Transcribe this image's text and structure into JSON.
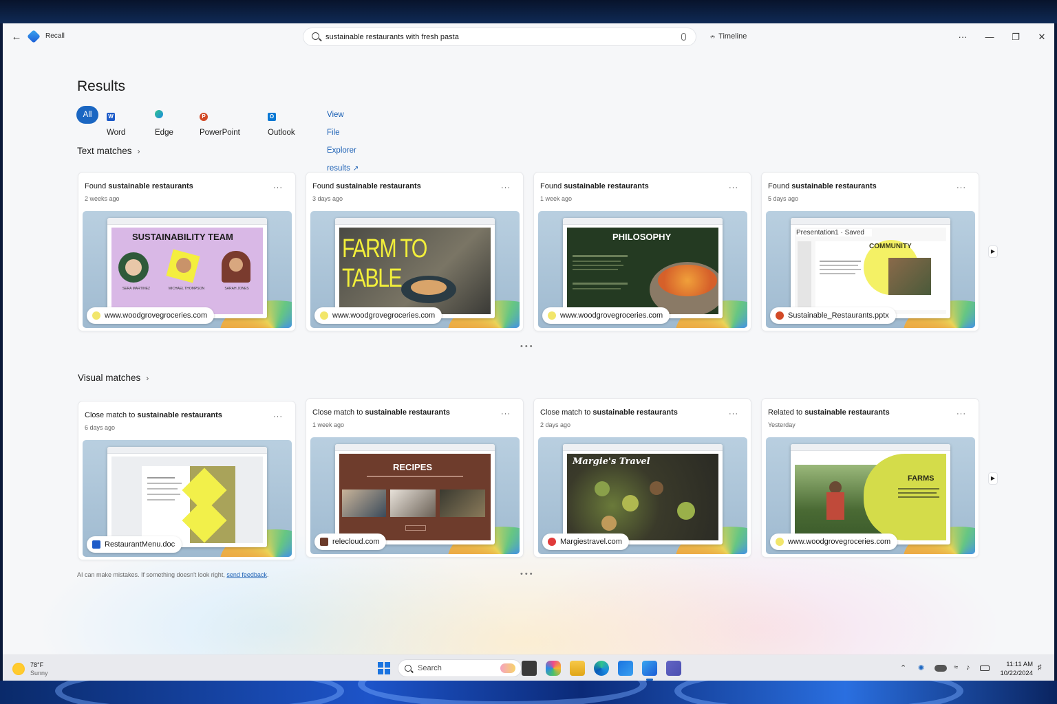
{
  "window": {
    "app_name": "Recall",
    "search_value": "sustainable restaurants with fresh pasta",
    "timeline_label": "Timeline"
  },
  "results": {
    "title": "Results",
    "filters": {
      "all": "All",
      "word": "Word",
      "edge": "Edge",
      "powerpoint": "PowerPoint",
      "outlook": "Outlook",
      "file_explorer": "View File Explorer results"
    }
  },
  "text_matches": {
    "heading": "Text matches",
    "cards": [
      {
        "prefix": "Found ",
        "term": "sustainable restaurants",
        "time": "2 weeks ago",
        "source": "www.woodgrovegroceries.com",
        "slide_title": "SUSTAINABILITY TEAM",
        "people": [
          "SERA MARTINEZ",
          "MICHAEL THOMPSON",
          "SARAH JONES"
        ]
      },
      {
        "prefix": "Found ",
        "term": "sustainable restaurants",
        "time": "3 days ago",
        "source": "www.woodgrovegroceries.com",
        "slide_title": "FARM TO TABLE"
      },
      {
        "prefix": "Found ",
        "term": "sustainable restaurants",
        "time": "1 week ago",
        "source": "www.woodgrovegroceries.com",
        "slide_title": "PHILOSOPHY"
      },
      {
        "prefix": "Found ",
        "term": "sustainable restaurants",
        "time": "5 days ago",
        "source": "Sustainable_Restaurants.pptx",
        "slide_title": "COMMUNITY",
        "doc_title": "Presentation1 · Saved"
      }
    ]
  },
  "visual_matches": {
    "heading": "Visual matches",
    "cards": [
      {
        "prefix": "Close match to ",
        "term": "sustainable restaurants",
        "time": "6 days ago",
        "source": "RestaurantMenu.doc"
      },
      {
        "prefix": "Close match to ",
        "term": "sustainable restaurants",
        "time": "1 week ago",
        "source": "relecloud.com",
        "slide_title": "RECIPES"
      },
      {
        "prefix": "Close match to ",
        "term": "sustainable restaurants",
        "time": "2 days ago",
        "source": "Margiestravel.com",
        "slide_title": "Margie's Travel"
      },
      {
        "prefix": "Related to ",
        "term": "sustainable restaurants",
        "time": "Yesterday",
        "source": "www.woodgrovegroceries.com",
        "slide_title": "FARMS"
      }
    ]
  },
  "disclaimer": {
    "text": "AI can make mistakes. If something doesn't look right, ",
    "link": "send feedback",
    "end": "."
  },
  "taskbar": {
    "temp": "78°F",
    "weather": "Sunny",
    "search_label": "Search",
    "time": "11:11 AM",
    "date": "10/22/2024"
  }
}
